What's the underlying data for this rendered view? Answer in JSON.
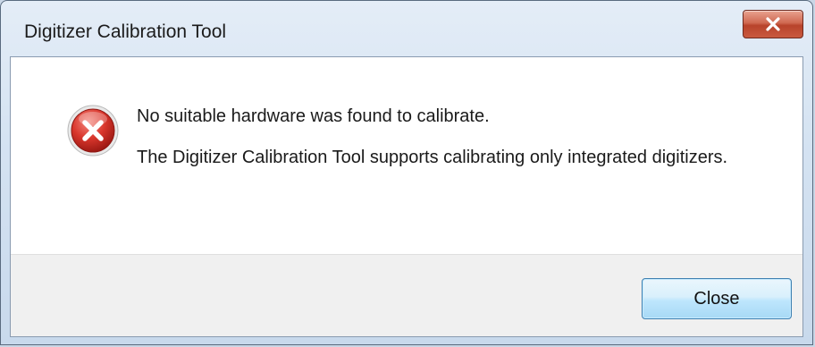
{
  "window": {
    "title": "Digitizer Calibration Tool"
  },
  "dialog": {
    "icon": "error-icon",
    "main_message": "No suitable hardware was found to calibrate.",
    "detail_message": "The Digitizer Calibration Tool supports calibrating only integrated digitizers."
  },
  "buttons": {
    "close_label": "Close"
  },
  "colors": {
    "error_red": "#d1342c",
    "title_close_button": "#c95a3f",
    "button_border": "#3c7fb1"
  }
}
